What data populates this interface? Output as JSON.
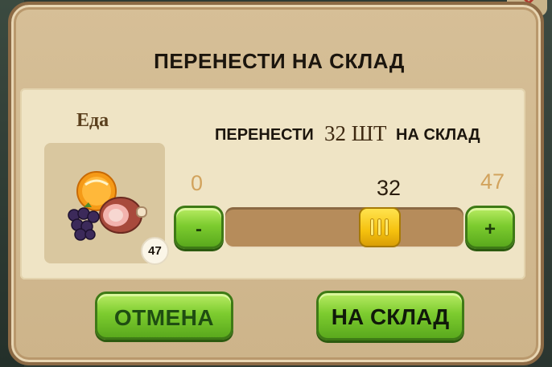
{
  "dialog": {
    "title": "ПЕРЕНЕСТИ НА СКЛАД",
    "item_label": "Еда",
    "item_icon": "food-bundle-icon",
    "item_count": "47"
  },
  "transfer": {
    "prefix": "ПЕРЕНЕСТИ",
    "quantity": "32 ШТ",
    "suffix": "НА СКЛАД"
  },
  "slider": {
    "min": "0",
    "max": "47",
    "current": "32",
    "value": 32,
    "range": [
      0,
      47
    ]
  },
  "buttons": {
    "minus": "-",
    "plus": "+",
    "cancel": "ОТМЕНА",
    "confirm": "НА СКЛАД"
  },
  "colors": {
    "button_green": "#7dcc2f",
    "knob_yellow": "#f5c10e",
    "panel": "#efe4c5"
  }
}
